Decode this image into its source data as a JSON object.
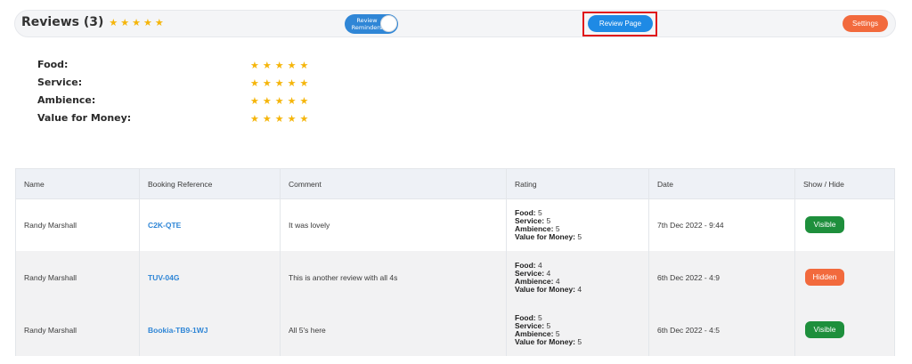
{
  "header": {
    "title": "Reviews (3)",
    "rating_stars": 5,
    "toggle_label_line1": "Review",
    "toggle_label_line2": "Reminders",
    "review_page_label": "Review Page",
    "settings_label": "Settings"
  },
  "categories": [
    {
      "label": "Food:",
      "stars": 5
    },
    {
      "label": "Service:",
      "stars": 5
    },
    {
      "label": "Ambience:",
      "stars": 5
    },
    {
      "label": "Value for Money:",
      "stars": 5
    }
  ],
  "table": {
    "columns": [
      "Name",
      "Booking Reference",
      "Comment",
      "Rating",
      "Date",
      "Show / Hide"
    ],
    "rows": [
      {
        "name": "Randy Marshall",
        "ref": "C2K-QTE",
        "comment": "It was lovely",
        "rating": {
          "food": "5",
          "service": "5",
          "ambience": "5",
          "value": "5"
        },
        "date": "7th Dec 2022 - 9:44",
        "status": "Visible"
      },
      {
        "name": "Randy Marshall",
        "ref": "TUV-04G",
        "comment": "This is another review with all 4s",
        "rating": {
          "food": "4",
          "service": "4",
          "ambience": "4",
          "value": "4"
        },
        "date": "6th Dec 2022 - 4:9",
        "status": "Hidden"
      },
      {
        "name": "Randy Marshall",
        "ref": "Bookia-TB9-1WJ",
        "comment": "All 5's here",
        "rating": {
          "food": "5",
          "service": "5",
          "ambience": "5",
          "value": "5"
        },
        "date": "6th Dec 2022 - 4:5",
        "status": "Visible"
      }
    ],
    "rating_labels": {
      "food": "Food:",
      "service": "Service:",
      "ambience": "Ambience:",
      "value": "Value for Money:"
    }
  },
  "colors": {
    "accent_blue": "#1e8ae5",
    "star_gold": "#f5b50a",
    "visible_green": "#1e8f3c",
    "hidden_orange": "#f26a3d",
    "highlight_red": "#e0131a"
  }
}
